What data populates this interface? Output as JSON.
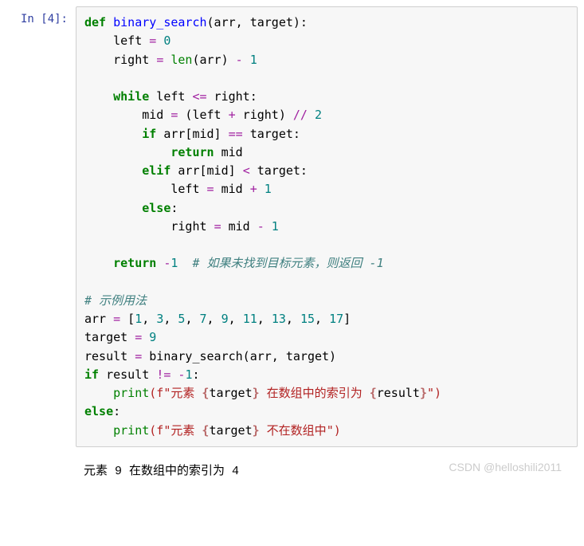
{
  "prompt": "In  [4]:",
  "code": {
    "l1_def": "def",
    "l1_fn": " binary_search",
    "l1_rest": "(arr, target):",
    "l2_txt": "    left ",
    "l2_eq": "=",
    "l2_num": " 0",
    "l3_txt": "    right ",
    "l3_eq": "=",
    "l3_len": " len",
    "l3_rest": "(arr) ",
    "l3_minus": "-",
    "l3_one": " 1",
    "l5_while": "    while",
    "l5_txt": " left ",
    "l5_le": "<=",
    "l5_rest": " right:",
    "l6_txt": "        mid ",
    "l6_eq": "=",
    "l6_rest": " (left ",
    "l6_plus": "+",
    "l6_rest2": " right) ",
    "l6_div": "//",
    "l6_two": " 2",
    "l7_if": "        if",
    "l7_rest": " arr[mid] ",
    "l7_eq": "==",
    "l7_rest2": " target:",
    "l8_ret": "            return",
    "l8_rest": " mid",
    "l9_elif": "        elif",
    "l9_rest": " arr[mid] ",
    "l9_lt": "<",
    "l9_rest2": " target:",
    "l10_txt": "            left ",
    "l10_eq": "=",
    "l10_rest": " mid ",
    "l10_plus": "+",
    "l10_one": " 1",
    "l11_else": "        else",
    "l11_colon": ":",
    "l12_txt": "            right ",
    "l12_eq": "=",
    "l12_rest": " mid ",
    "l12_minus": "-",
    "l12_one": " 1",
    "l14_ret": "    return",
    "l14_sp": " ",
    "l14_minus": "-",
    "l14_one": "1",
    "l14_sp2": "  ",
    "l14_cmt": "# 如果未找到目标元素，则返回 -1",
    "l16_cmt": "# 示例用法",
    "l17_txt": "arr ",
    "l17_eq": "=",
    "l17_rest": " [",
    "l17_n1": "1",
    "l17_c": ", ",
    "l17_n3": "3",
    "l17_n5": "5",
    "l17_n7": "7",
    "l17_n9": "9",
    "l17_n11": "11",
    "l17_n13": "13",
    "l17_n15": "15",
    "l17_n17": "17",
    "l17_close": "]",
    "l18_txt": "target ",
    "l18_eq": "=",
    "l18_num": " 9",
    "l19_txt": "result ",
    "l19_eq": "=",
    "l19_rest": " binary_search(arr, target)",
    "l20_if": "if",
    "l20_rest": " result ",
    "l20_ne": "!=",
    "l20_sp": " ",
    "l20_minus": "-",
    "l20_one": "1",
    "l20_colon": ":",
    "l21_print": "    print",
    "l21_s1": "(f\"元素 ",
    "l21_si1a": "{",
    "l21_si1b": "target",
    "l21_si1c": "}",
    "l21_s2": " 在数组中的索引为 ",
    "l21_si2a": "{",
    "l21_si2b": "result",
    "l21_si2c": "}",
    "l21_s3": "\")",
    "l22_else": "else",
    "l22_colon": ":",
    "l23_print": "    print",
    "l23_s1": "(f\"元素 ",
    "l23_sia": "{",
    "l23_sib": "target",
    "l23_sic": "}",
    "l23_s2": " 不在数组中\")"
  },
  "output": "元素 9 在数组中的索引为 4",
  "watermark": "CSDN @helloshili2011"
}
